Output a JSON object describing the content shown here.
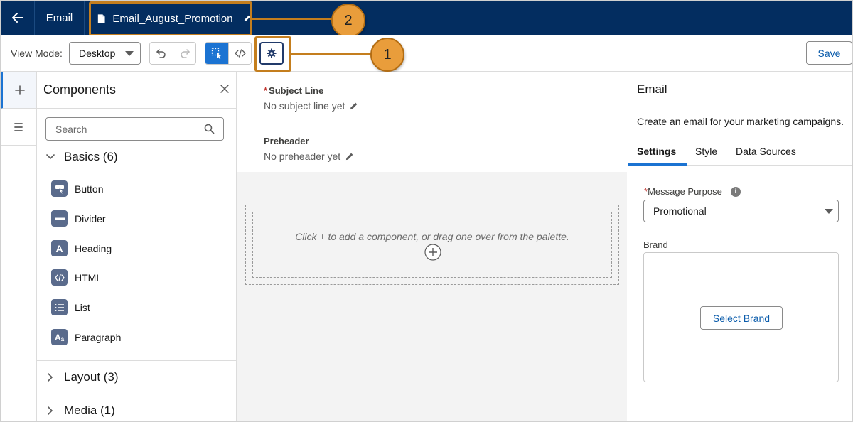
{
  "header": {
    "back_icon": "arrow-left-icon",
    "app_label": "Email",
    "doc_icon": "document-icon",
    "doc_title": "Email_August_Promotion",
    "edit_icon": "pencil-icon",
    "bg_color": "#032d60"
  },
  "toolbar": {
    "view_mode_label": "View Mode:",
    "view_mode_value": "Desktop",
    "undo_icon": "undo-icon",
    "redo_icon": "redo-icon",
    "select_mode_icon": "select-mode-icon",
    "code_mode_icon": "code-icon",
    "settings_icon": "gear-icon",
    "save_label": "Save"
  },
  "callouts": {
    "one": "1",
    "two": "2",
    "color": "#c47e1e"
  },
  "rail": {
    "items": [
      {
        "icon": "plus-icon"
      },
      {
        "icon": "list-icon"
      }
    ]
  },
  "components": {
    "title": "Components",
    "close_icon": "close-icon",
    "search_placeholder": "Search",
    "sections": {
      "basics": "Basics (6)",
      "layout": "Layout (3)",
      "media": "Media (1)"
    },
    "items": [
      {
        "label": "Button",
        "icon": "button-icon"
      },
      {
        "label": "Divider",
        "icon": "divider-icon"
      },
      {
        "label": "Heading",
        "icon": "heading-icon"
      },
      {
        "label": "HTML",
        "icon": "html-icon"
      },
      {
        "label": "List",
        "icon": "list-icon"
      },
      {
        "label": "Paragraph",
        "icon": "paragraph-icon"
      }
    ]
  },
  "canvas": {
    "subject_label": "Subject Line",
    "subject_value": "No subject line yet",
    "preheader_label": "Preheader",
    "preheader_value": "No preheader yet",
    "drop_text": "Click + to add a component, or drag one over from the palette."
  },
  "properties": {
    "title": "Email",
    "description": "Create an email for your marketing campaigns.",
    "tabs": [
      "Settings",
      "Style",
      "Data Sources"
    ],
    "active_tab": "Settings",
    "message_purpose_label": "Message Purpose",
    "message_purpose_value": "Promotional",
    "brand_label": "Brand",
    "select_brand_label": "Select Brand",
    "accent_color": "#1b73d2"
  }
}
